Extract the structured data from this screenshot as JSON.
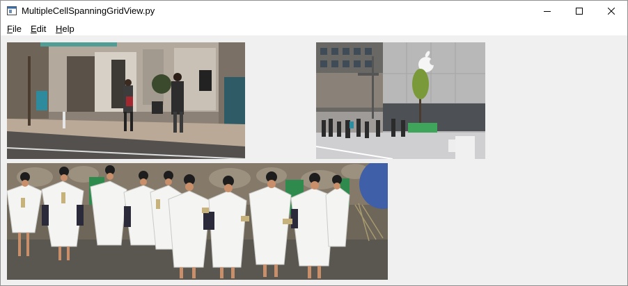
{
  "window": {
    "title": "MultipleCellSpanningGridView.py",
    "icon": "python-window-icon",
    "controls": [
      "minimize-icon",
      "maximize-icon",
      "close-icon"
    ]
  },
  "menu": {
    "items": [
      {
        "label": "File",
        "accel": "F"
      },
      {
        "label": "Edit",
        "accel": "E"
      },
      {
        "label": "Help",
        "accel": "H"
      }
    ]
  },
  "grid": {
    "images": [
      {
        "name": "street-sidewalk-photo"
      },
      {
        "name": "apple-store-crossing-photo"
      },
      {
        "name": "festival-procession-photo"
      }
    ]
  },
  "colors": {
    "window_bg": "#f0f0f0",
    "titlebar_bg": "#ffffff",
    "text": "#000000"
  }
}
